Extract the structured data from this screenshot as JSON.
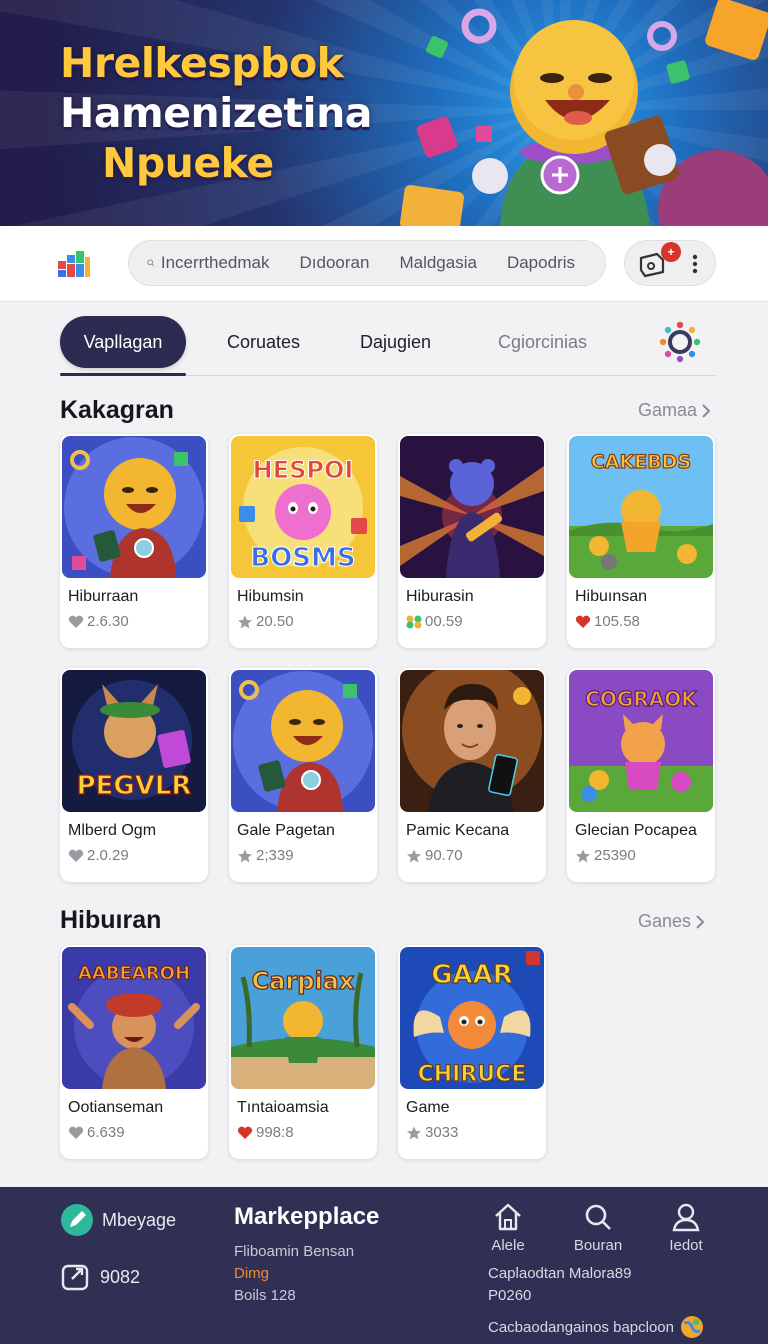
{
  "hero": {
    "title_line1": "Hrelkespbok",
    "title_line2": "Hamenizetina",
    "title_line3": "Npueke"
  },
  "header": {
    "search_items": [
      "Incerrthedmak",
      "Dıdooran",
      "Maldgasia",
      "Dapodris"
    ],
    "notification_badge": "+",
    "accent_color": "#2c2c52"
  },
  "tabs": [
    {
      "label": "Vapllagan",
      "active": true
    },
    {
      "label": "Coruates",
      "active": false
    },
    {
      "label": "Dajugien",
      "active": false
    },
    {
      "label": "Cgiorcinias",
      "active": false
    }
  ],
  "section1": {
    "title": "Kakagran",
    "link": "Gamaa",
    "cards": [
      {
        "name": "Hiburraan",
        "meta": "2.6.30",
        "icon": "heart-icon"
      },
      {
        "name": "Hibumsin",
        "meta": "20.50",
        "icon": "star-icon"
      },
      {
        "name": "Hiburasin",
        "meta": "00.59",
        "icon": "coins-icon"
      },
      {
        "name": "Hibuınsan",
        "meta": "105.58",
        "icon": "heart-icon"
      },
      {
        "name": "Mlberd Ogm",
        "meta": "2.0.29",
        "icon": "heart-icon"
      },
      {
        "name": "Gale Pagetan",
        "meta": "2;339",
        "icon": "star-icon"
      },
      {
        "name": "Pamic Kecana",
        "meta": "90.70",
        "icon": "star-icon"
      },
      {
        "name": "Glecian Pocapea",
        "meta": "25390",
        "icon": "star-icon"
      }
    ]
  },
  "section2": {
    "title": "Hibuıran",
    "link": "Ganes",
    "cards": [
      {
        "name": "Ootianseman",
        "meta": "6.639",
        "icon": "heart-icon"
      },
      {
        "name": "Tıntaioamsia",
        "meta": "998:8",
        "icon": "heart-icon"
      },
      {
        "name": "Game",
        "meta": "3033",
        "icon": "star-icon"
      }
    ]
  },
  "thumb_texts": {
    "c2": "HESPOI",
    "c2b": "BOSMS",
    "c4": "CAKEBDS",
    "c5": "PEGVLR",
    "c8": "COGRAOK",
    "c9": "AABEAROH",
    "c10": "Carpiax",
    "c11": "GAAR",
    "c11b": "CHIRUCE"
  },
  "footer": {
    "left1": "Mbeyage",
    "left2": "9082",
    "brand": "Markepplace",
    "line1": "Fliboamin Bensan",
    "line2": "Dimg",
    "line3": "Boils 128",
    "nav": [
      {
        "label": "Alele",
        "icon": "home-icon"
      },
      {
        "label": "Bouran",
        "icon": "search-icon"
      },
      {
        "label": "Iedot",
        "icon": "user-icon"
      }
    ],
    "extra1": "Caplaodtan Malora89",
    "extra2": "P0260",
    "extra3": "Cacbaodangainos bapcloon"
  }
}
